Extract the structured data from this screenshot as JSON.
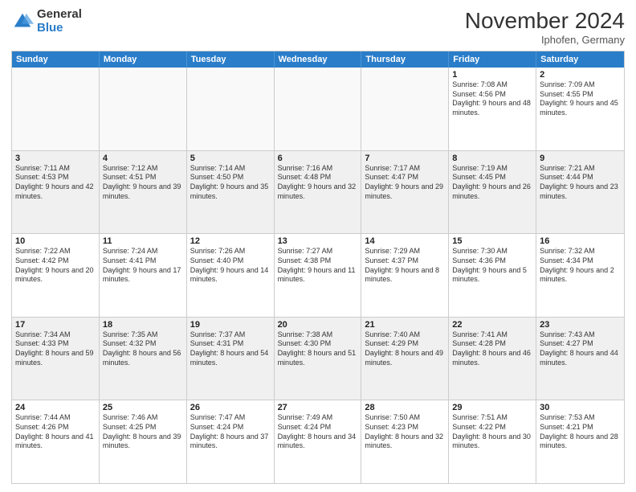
{
  "logo": {
    "general": "General",
    "blue": "Blue"
  },
  "header": {
    "month": "November 2024",
    "location": "Iphofen, Germany"
  },
  "weekdays": [
    "Sunday",
    "Monday",
    "Tuesday",
    "Wednesday",
    "Thursday",
    "Friday",
    "Saturday"
  ],
  "rows": [
    [
      {
        "day": "",
        "info": ""
      },
      {
        "day": "",
        "info": ""
      },
      {
        "day": "",
        "info": ""
      },
      {
        "day": "",
        "info": ""
      },
      {
        "day": "",
        "info": ""
      },
      {
        "day": "1",
        "info": "Sunrise: 7:08 AM\nSunset: 4:56 PM\nDaylight: 9 hours and 48 minutes."
      },
      {
        "day": "2",
        "info": "Sunrise: 7:09 AM\nSunset: 4:55 PM\nDaylight: 9 hours and 45 minutes."
      }
    ],
    [
      {
        "day": "3",
        "info": "Sunrise: 7:11 AM\nSunset: 4:53 PM\nDaylight: 9 hours and 42 minutes."
      },
      {
        "day": "4",
        "info": "Sunrise: 7:12 AM\nSunset: 4:51 PM\nDaylight: 9 hours and 39 minutes."
      },
      {
        "day": "5",
        "info": "Sunrise: 7:14 AM\nSunset: 4:50 PM\nDaylight: 9 hours and 35 minutes."
      },
      {
        "day": "6",
        "info": "Sunrise: 7:16 AM\nSunset: 4:48 PM\nDaylight: 9 hours and 32 minutes."
      },
      {
        "day": "7",
        "info": "Sunrise: 7:17 AM\nSunset: 4:47 PM\nDaylight: 9 hours and 29 minutes."
      },
      {
        "day": "8",
        "info": "Sunrise: 7:19 AM\nSunset: 4:45 PM\nDaylight: 9 hours and 26 minutes."
      },
      {
        "day": "9",
        "info": "Sunrise: 7:21 AM\nSunset: 4:44 PM\nDaylight: 9 hours and 23 minutes."
      }
    ],
    [
      {
        "day": "10",
        "info": "Sunrise: 7:22 AM\nSunset: 4:42 PM\nDaylight: 9 hours and 20 minutes."
      },
      {
        "day": "11",
        "info": "Sunrise: 7:24 AM\nSunset: 4:41 PM\nDaylight: 9 hours and 17 minutes."
      },
      {
        "day": "12",
        "info": "Sunrise: 7:26 AM\nSunset: 4:40 PM\nDaylight: 9 hours and 14 minutes."
      },
      {
        "day": "13",
        "info": "Sunrise: 7:27 AM\nSunset: 4:38 PM\nDaylight: 9 hours and 11 minutes."
      },
      {
        "day": "14",
        "info": "Sunrise: 7:29 AM\nSunset: 4:37 PM\nDaylight: 9 hours and 8 minutes."
      },
      {
        "day": "15",
        "info": "Sunrise: 7:30 AM\nSunset: 4:36 PM\nDaylight: 9 hours and 5 minutes."
      },
      {
        "day": "16",
        "info": "Sunrise: 7:32 AM\nSunset: 4:34 PM\nDaylight: 9 hours and 2 minutes."
      }
    ],
    [
      {
        "day": "17",
        "info": "Sunrise: 7:34 AM\nSunset: 4:33 PM\nDaylight: 8 hours and 59 minutes."
      },
      {
        "day": "18",
        "info": "Sunrise: 7:35 AM\nSunset: 4:32 PM\nDaylight: 8 hours and 56 minutes."
      },
      {
        "day": "19",
        "info": "Sunrise: 7:37 AM\nSunset: 4:31 PM\nDaylight: 8 hours and 54 minutes."
      },
      {
        "day": "20",
        "info": "Sunrise: 7:38 AM\nSunset: 4:30 PM\nDaylight: 8 hours and 51 minutes."
      },
      {
        "day": "21",
        "info": "Sunrise: 7:40 AM\nSunset: 4:29 PM\nDaylight: 8 hours and 49 minutes."
      },
      {
        "day": "22",
        "info": "Sunrise: 7:41 AM\nSunset: 4:28 PM\nDaylight: 8 hours and 46 minutes."
      },
      {
        "day": "23",
        "info": "Sunrise: 7:43 AM\nSunset: 4:27 PM\nDaylight: 8 hours and 44 minutes."
      }
    ],
    [
      {
        "day": "24",
        "info": "Sunrise: 7:44 AM\nSunset: 4:26 PM\nDaylight: 8 hours and 41 minutes."
      },
      {
        "day": "25",
        "info": "Sunrise: 7:46 AM\nSunset: 4:25 PM\nDaylight: 8 hours and 39 minutes."
      },
      {
        "day": "26",
        "info": "Sunrise: 7:47 AM\nSunset: 4:24 PM\nDaylight: 8 hours and 37 minutes."
      },
      {
        "day": "27",
        "info": "Sunrise: 7:49 AM\nSunset: 4:24 PM\nDaylight: 8 hours and 34 minutes."
      },
      {
        "day": "28",
        "info": "Sunrise: 7:50 AM\nSunset: 4:23 PM\nDaylight: 8 hours and 32 minutes."
      },
      {
        "day": "29",
        "info": "Sunrise: 7:51 AM\nSunset: 4:22 PM\nDaylight: 8 hours and 30 minutes."
      },
      {
        "day": "30",
        "info": "Sunrise: 7:53 AM\nSunset: 4:21 PM\nDaylight: 8 hours and 28 minutes."
      }
    ]
  ]
}
